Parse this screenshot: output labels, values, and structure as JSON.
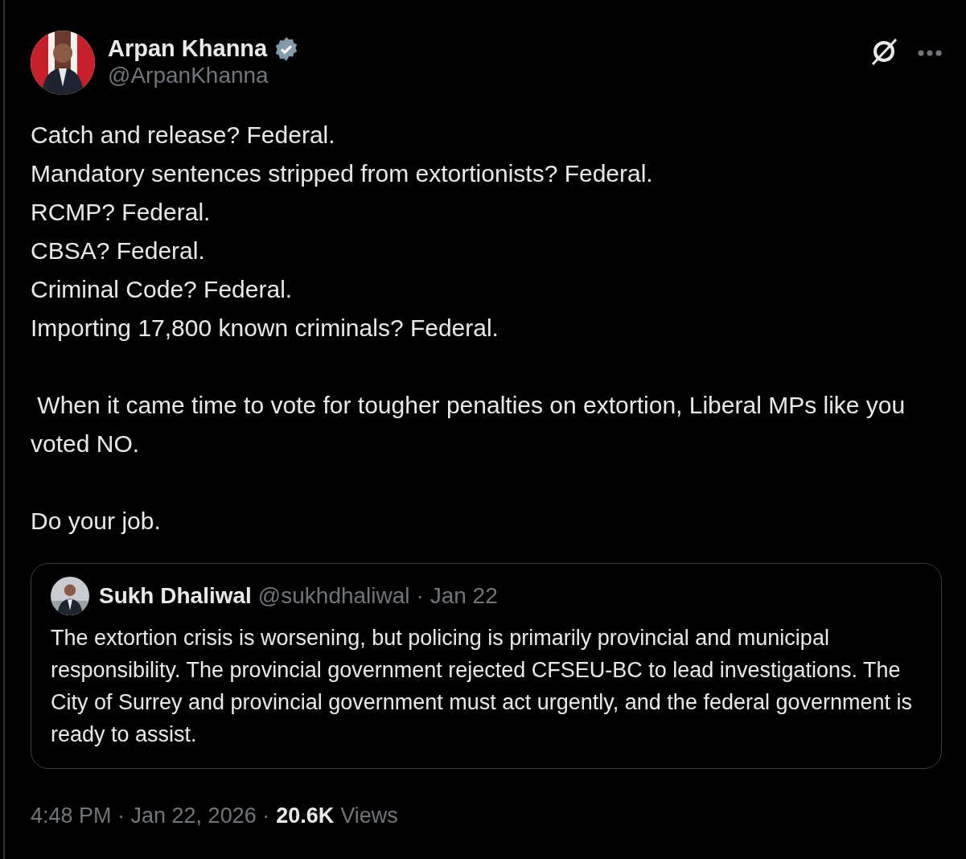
{
  "author": {
    "name": "Arpan Khanna",
    "verified": true,
    "handle": "@ArpanKhanna"
  },
  "paragraphs": [
    [
      "Catch and release? Federal.",
      "Mandatory sentences stripped from extortionists? Federal.",
      "RCMP? Federal.",
      "CBSA? Federal.",
      "Criminal Code? Federal.",
      "Importing 17,800 known criminals? Federal."
    ],
    [
      " When it came time to vote for tougher penalties on extortion, Liberal MPs like you voted NO."
    ],
    [
      "Do your job."
    ]
  ],
  "quoted": {
    "name": "Sukh Dhaliwal",
    "handle": "@sukhdhaliwal",
    "date": "· Jan 22",
    "text": "The extortion crisis is worsening, but policing is primarily provincial and municipal responsibility. The provincial government rejected CFSEU-BC to lead investigations. The City of Surrey and provincial government must act urgently, and the federal government is ready to assist."
  },
  "footer": {
    "timestamp": "4:48 PM · Jan 22, 2026 ·",
    "views_count": "20.6K",
    "views_label": "Views"
  }
}
